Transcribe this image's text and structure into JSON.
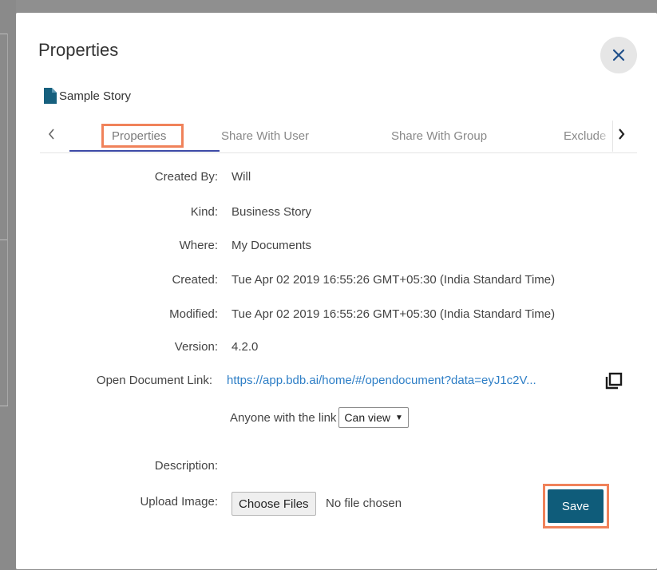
{
  "dialog": {
    "title": "Properties",
    "document_name": "Sample Story"
  },
  "tabs": [
    {
      "label": "Properties"
    },
    {
      "label": "Share With User"
    },
    {
      "label": "Share With Group"
    },
    {
      "label": "Exclude"
    }
  ],
  "properties": {
    "created_by_label": "Created By:",
    "created_by_value": "Will",
    "kind_label": "Kind:",
    "kind_value": "Business Story",
    "where_label": "Where:",
    "where_value": "My Documents",
    "created_label": "Created:",
    "created_value": "Tue Apr 02 2019 16:55:26 GMT+05:30 (India Standard Time)",
    "modified_label": "Modified:",
    "modified_value": "Tue Apr 02 2019 16:55:26 GMT+05:30 (India Standard Time)",
    "version_label": "Version:",
    "version_value": "4.2.0",
    "link_label": "Open Document Link:",
    "link_value": "https://app.bdb.ai/home/#/opendocument?data=eyJ1c2V...",
    "share_text": "Anyone with the link",
    "share_option": "Can view",
    "description_label": "Description:",
    "upload_label": "Upload Image:",
    "choose_files_label": "Choose Files",
    "file_status": "No file chosen"
  },
  "actions": {
    "save_label": "Save"
  },
  "colors": {
    "accent": "#3d4aa6",
    "highlight": "#f0825a",
    "save": "#0f5c7a",
    "link": "#2d7ec6"
  },
  "icons": [
    "close-icon",
    "document-icon",
    "chevron-left-icon",
    "chevron-right-icon",
    "copy-icon"
  ]
}
